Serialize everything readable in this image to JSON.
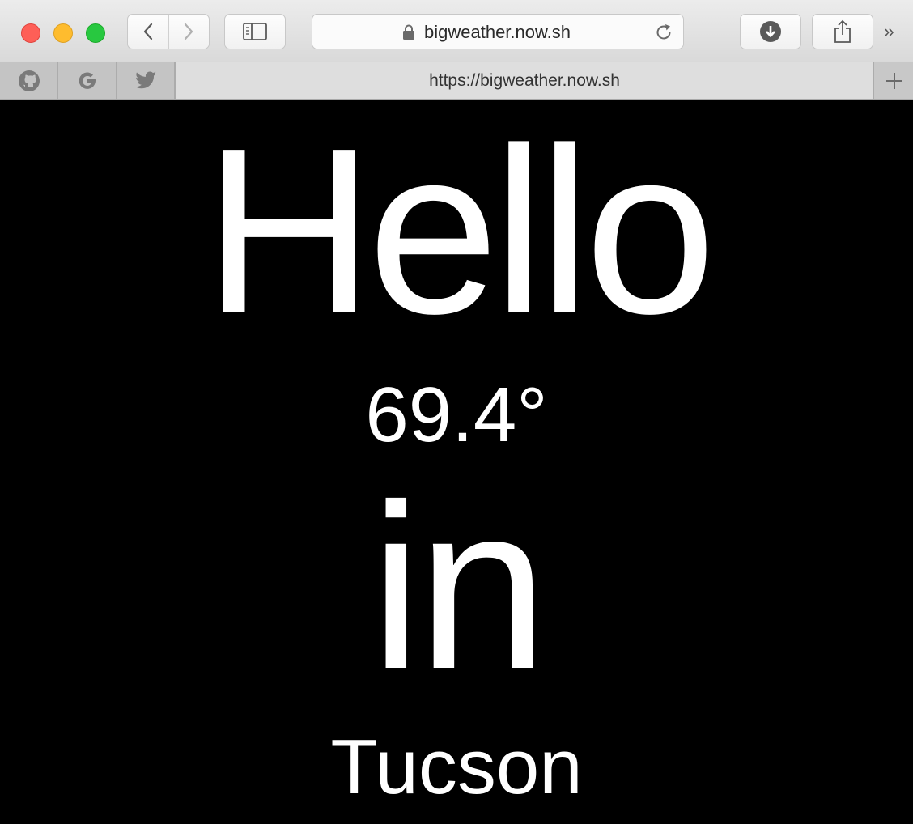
{
  "browser": {
    "address_bar": {
      "url_display": "bigweather.now.sh"
    },
    "tab": {
      "title": "https://bigweather.now.sh"
    },
    "pinned_tabs": [
      {
        "icon": "github-icon"
      },
      {
        "icon": "google-icon"
      },
      {
        "icon": "twitter-icon"
      }
    ],
    "colors": {
      "close": "#fe5f57",
      "minimize": "#febc2e",
      "maximize": "#28c840"
    }
  },
  "page": {
    "greeting": "Hello",
    "temperature": "69.4°",
    "preposition": "in",
    "city": "Tucson",
    "background": "#000000",
    "text_color": "#ffffff"
  }
}
